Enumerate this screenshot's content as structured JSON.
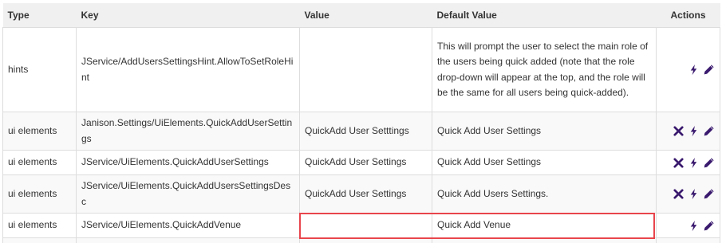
{
  "headers": {
    "type": "Type",
    "key": "Key",
    "value": "Value",
    "default_value": "Default Value",
    "actions": "Actions"
  },
  "rows": [
    {
      "type": "hints",
      "key": "JService/AddUsersSettingsHint.AllowToSetRoleHint",
      "value": "",
      "default_value": "This will prompt the user to select the main role of the users being quick added (note that the role drop-down will appear at the top, and the role will be the same for all users being quick-added).",
      "actions": [
        "bolt-icon",
        "pencil-icon"
      ]
    },
    {
      "type": "ui elements",
      "key": "Janison.Settings/UiElements.QuickAddUserSettings",
      "value": "QuickAdd User Setttings",
      "default_value": "Quick Add User Settings",
      "actions": [
        "close-icon",
        "bolt-icon",
        "pencil-icon"
      ]
    },
    {
      "type": "ui elements",
      "key": "JService/UiElements.QuickAddUserSettings",
      "value": "QuickAdd User Settings",
      "default_value": "Quick Add User Settings",
      "actions": [
        "close-icon",
        "bolt-icon",
        "pencil-icon"
      ]
    },
    {
      "type": "ui elements",
      "key": "JService/UiElements.QuickAddUsersSettingsDesc",
      "value": "QuickAdd User Settings",
      "default_value": "Quick Add Users Settings.",
      "actions": [
        "close-icon",
        "bolt-icon",
        "pencil-icon"
      ]
    },
    {
      "type": "ui elements",
      "key": "JService/UiElements.QuickAddVenue",
      "value": "",
      "default_value": "Quick Add Venue",
      "actions": [
        "bolt-icon",
        "pencil-icon"
      ]
    }
  ],
  "colors": {
    "icon": "#3a1a6e",
    "highlight": "#e8454c",
    "header_bg": "#f0f0f0",
    "row_alt_bg": "#f9f9f9",
    "border": "#dddddd"
  }
}
